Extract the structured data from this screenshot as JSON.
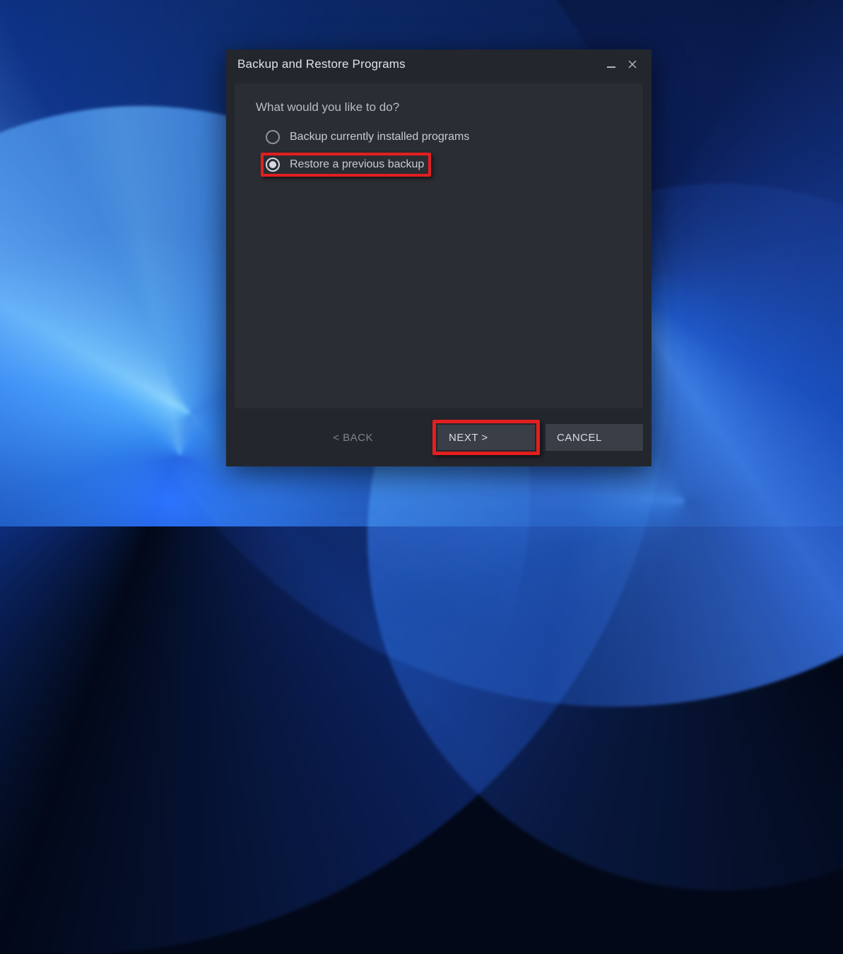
{
  "dialog": {
    "title": "Backup and Restore Programs",
    "prompt": "What would you like to do?",
    "options": {
      "backup": {
        "label": "Backup currently installed programs",
        "selected": false
      },
      "restore": {
        "label": "Restore a previous backup",
        "selected": true
      }
    },
    "buttons": {
      "back": "< BACK",
      "next": "NEXT >",
      "cancel": "CANCEL"
    }
  },
  "highlights": {
    "restore_option": true,
    "next_button": true
  },
  "colors": {
    "dialog_bg": "#23262c",
    "panel_bg": "#2a2d33",
    "button_bg": "#3a3e46",
    "highlight": "#e21f1f",
    "text": "#d9dde3"
  }
}
